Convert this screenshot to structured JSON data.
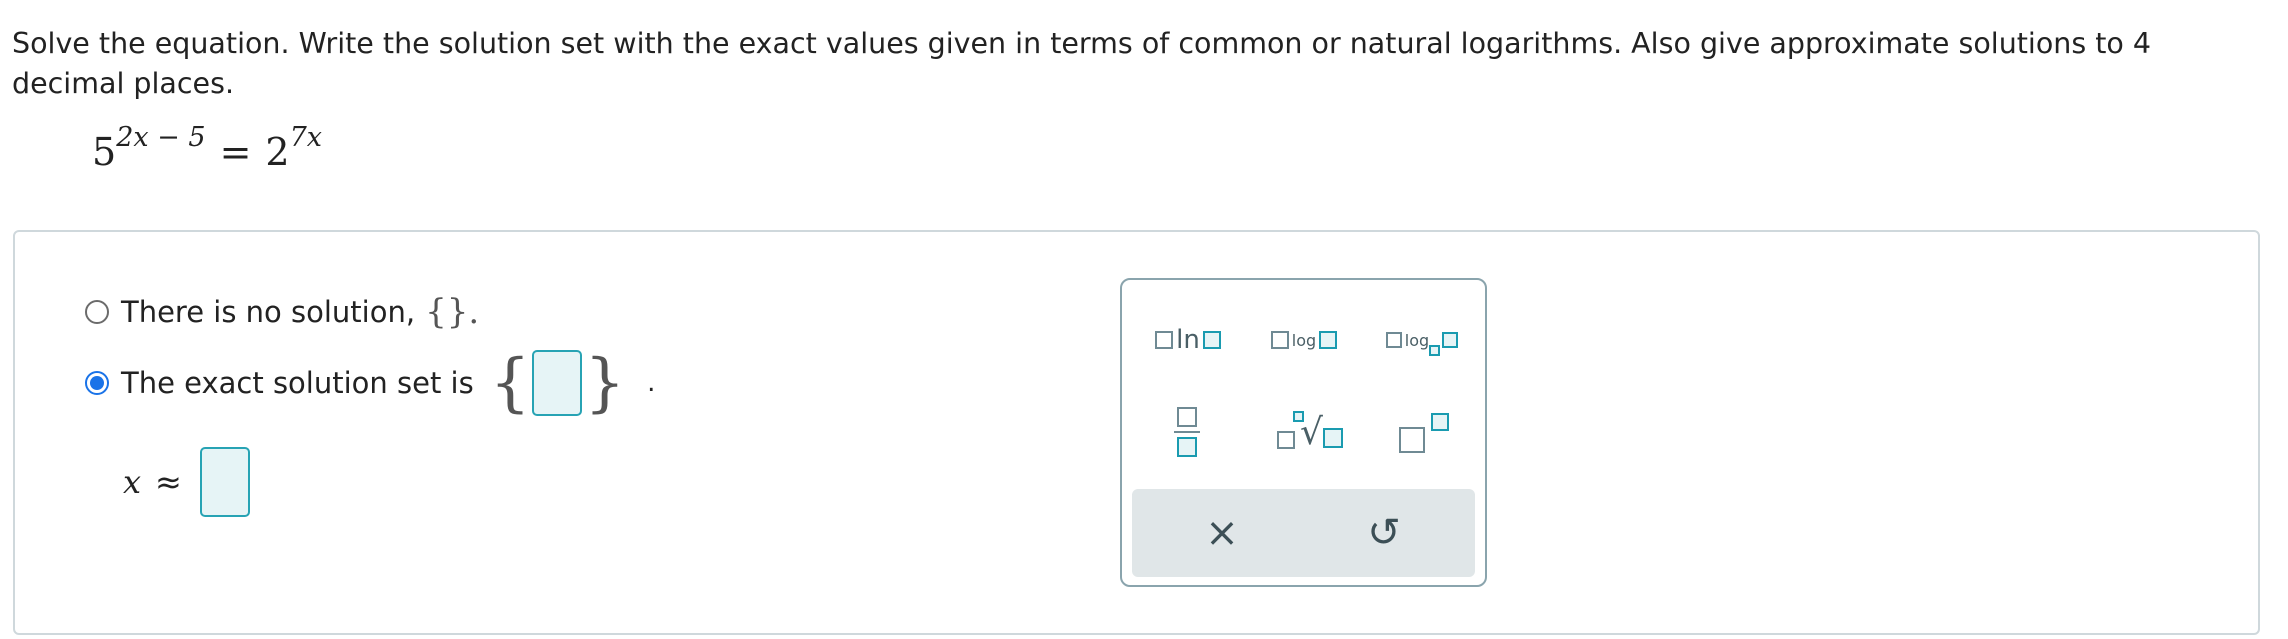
{
  "question": {
    "prompt": "Solve the equation. Write the solution set with the exact values given in terms of common or natural logarithms. Also give approximate solutions to 4 decimal places.",
    "equation": {
      "lhs_base": "5",
      "lhs_exponent": "2x − 5",
      "equals": "=",
      "rhs_base": "2",
      "rhs_exponent": "7x"
    }
  },
  "answer": {
    "choices": [
      {
        "label": "There is no solution,",
        "suffix": "{}.",
        "selected": false
      },
      {
        "label": "The exact solution set is",
        "suffix": ".",
        "selected": true
      }
    ],
    "approx": {
      "variable": "x",
      "symbol": "≈",
      "value": ""
    },
    "exact_input_value": ""
  },
  "palette": {
    "buttons": [
      {
        "name": "natural-log",
        "text": "ln"
      },
      {
        "name": "common-log",
        "text": "log"
      },
      {
        "name": "log-base",
        "text": "log"
      },
      {
        "name": "fraction",
        "text": ""
      },
      {
        "name": "nth-root",
        "text": "√"
      },
      {
        "name": "exponent",
        "text": ""
      }
    ],
    "footer": {
      "clear_icon": "×",
      "undo_icon": "↺"
    }
  },
  "colors": {
    "accent": "#1a73e8",
    "input_border": "#27a3b4",
    "input_fill": "#e6f4f6"
  }
}
